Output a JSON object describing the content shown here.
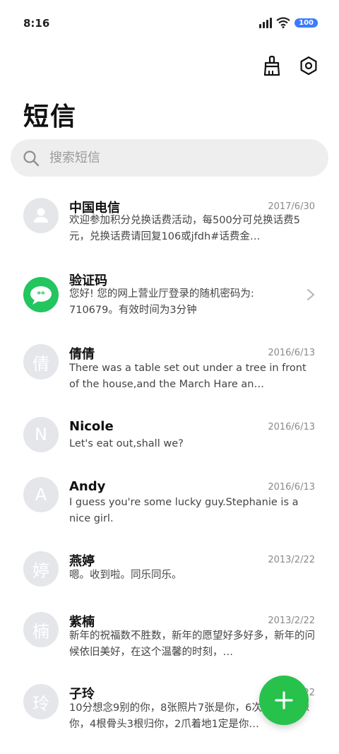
{
  "status_bar": {
    "time": "8:16",
    "battery": "100"
  },
  "header": {
    "title": "短信"
  },
  "search": {
    "placeholder": "搜索短信"
  },
  "messages": [
    {
      "sender": "中国电信",
      "date": "2017/6/30",
      "avatar_text": "",
      "preview": "欢迎参加积分兑换话费活动，每500分可兑换话费5元，兑换话费请回复106或jfdh#话费金…"
    },
    {
      "sender": "验证码",
      "date": "",
      "avatar_text": "**",
      "preview": "您好! 您的网上营业厅登录的随机密码为: 710679。有效时间为3分钟"
    },
    {
      "sender": "倩倩",
      "date": "2016/6/13",
      "avatar_text": "倩",
      "preview": "There was a table set out under a tree in front of the house,and the March Hare an…"
    },
    {
      "sender": "Nicole",
      "date": "2016/6/13",
      "avatar_text": "N",
      "preview": "Let's eat out,shall we?"
    },
    {
      "sender": "Andy",
      "date": "2016/6/13",
      "avatar_text": "A",
      "preview": "I guess you're some lucky guy.Stephanie is a nice girl."
    },
    {
      "sender": "燕婷",
      "date": "2013/2/22",
      "avatar_text": "婷",
      "preview": "嗯。收到啦。同乐同乐。"
    },
    {
      "sender": "紫楠",
      "date": "2013/2/22",
      "avatar_text": "楠",
      "preview": "新年的祝福数不胜数，新年的愿望好多好多，新年的问候依旧美好，在这个温馨的时刻，…"
    },
    {
      "sender": "子玲",
      "date": "2013/2/22",
      "avatar_text": "玲",
      "preview": "10分想念9别的你，8张照片7张是你，6次梦里5只像你，4根骨头3根归你，2爪着地1定是你…"
    }
  ],
  "icons": {
    "clean": "broom-icon",
    "settings": "gear-icon",
    "search": "search-icon",
    "compose": "plus-icon",
    "contact": "person-icon",
    "chevron": "chevron-right-icon"
  },
  "colors": {
    "accent": "#27c24c",
    "avatar_bg": "#e4e6ea",
    "battery": "#3a7bff"
  }
}
